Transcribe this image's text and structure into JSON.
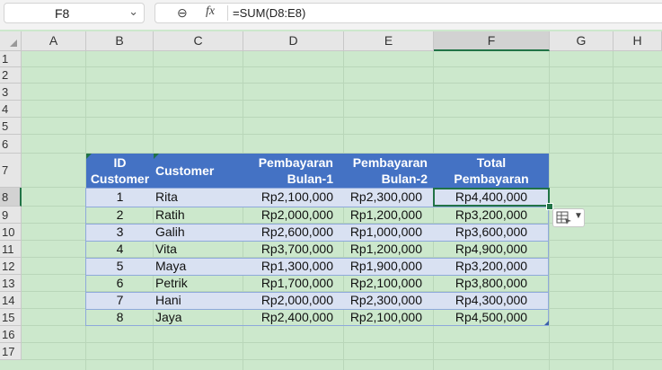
{
  "formula_bar": {
    "name_box": "F8",
    "formula": "=SUM(D8:E8)",
    "fx_label": "fx"
  },
  "columns": [
    "A",
    "B",
    "C",
    "D",
    "E",
    "F",
    "G",
    "H"
  ],
  "rows": [
    "1",
    "2",
    "3",
    "4",
    "5",
    "6",
    "7",
    "8",
    "9",
    "10",
    "11",
    "12",
    "13",
    "14",
    "15",
    "16",
    "17"
  ],
  "selected_cell": "F8",
  "table": {
    "headers": {
      "id": [
        "ID",
        "Customer"
      ],
      "customer": "Customer",
      "bulan1": [
        "Pembayaran",
        "Bulan-1"
      ],
      "bulan2": [
        "Pembayaran",
        "Bulan-2"
      ],
      "total": [
        "Total",
        "Pembayaran"
      ]
    },
    "rows": [
      {
        "id": "1",
        "customer": "Rita",
        "b1": "Rp2,100,000",
        "b2": "Rp2,300,000",
        "total": "Rp4,400,000"
      },
      {
        "id": "2",
        "customer": "Ratih",
        "b1": "Rp2,000,000",
        "b2": "Rp1,200,000",
        "total": "Rp3,200,000"
      },
      {
        "id": "3",
        "customer": "Galih",
        "b1": "Rp2,600,000",
        "b2": "Rp1,000,000",
        "total": "Rp3,600,000"
      },
      {
        "id": "4",
        "customer": "Vita",
        "b1": "Rp3,700,000",
        "b2": "Rp1,200,000",
        "total": "Rp4,900,000"
      },
      {
        "id": "5",
        "customer": "Maya",
        "b1": "Rp1,300,000",
        "b2": "Rp1,900,000",
        "total": "Rp3,200,000"
      },
      {
        "id": "6",
        "customer": "Petrik",
        "b1": "Rp1,700,000",
        "b2": "Rp2,100,000",
        "total": "Rp3,800,000"
      },
      {
        "id": "7",
        "customer": "Hani",
        "b1": "Rp2,000,000",
        "b2": "Rp2,300,000",
        "total": "Rp4,300,000"
      },
      {
        "id": "8",
        "customer": "Jaya",
        "b1": "Rp2,400,000",
        "b2": "Rp2,100,000",
        "total": "Rp4,500,000"
      }
    ]
  },
  "colors": {
    "header_fill": "#4472c4",
    "band_fill": "#d9e1f2",
    "sheet_bg": "#cce8cc",
    "selection": "#217346"
  },
  "icons": {
    "zoom": "zoom-out-icon",
    "quick_analysis": "quick-analysis-icon"
  }
}
